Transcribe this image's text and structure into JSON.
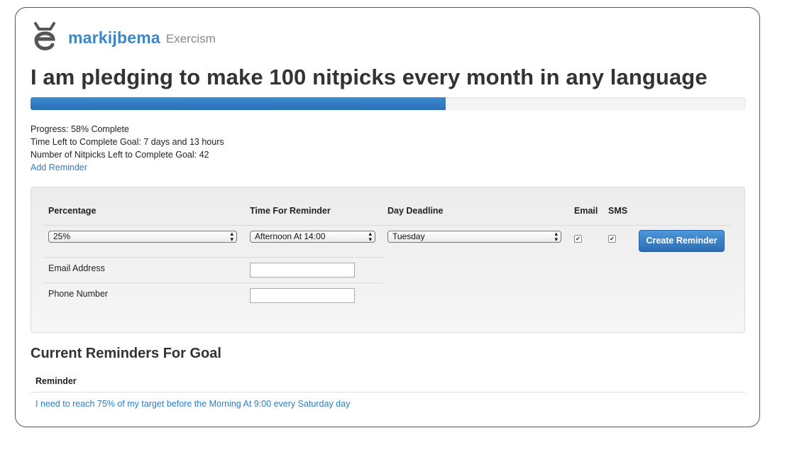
{
  "header": {
    "username": "markijbema",
    "app_name": "Exercism",
    "logo_icon": "exercism-logo-icon"
  },
  "goal": {
    "pledge_text": "I am pledging to make 100 nitpicks every month in any language",
    "progress_fraction": 0.58,
    "progress_text": "Progress: 58% Complete",
    "time_left_text": "Time Left to Complete Goal: 7 days and 13 hours",
    "nitpicks_left_text": "Number of Nitpicks Left to Complete Goal: 42",
    "add_reminder_link": "Add Reminder"
  },
  "form": {
    "headers": {
      "percentage": "Percentage",
      "time": "Time For Reminder",
      "day": "Day Deadline",
      "email": "Email",
      "sms": "SMS"
    },
    "percentage_value": "25%",
    "time_value": "Afternoon At 14:00",
    "day_value": "Tuesday",
    "email_checked": true,
    "sms_checked": true,
    "create_button": "Create Reminder",
    "email_label": "Email Address",
    "email_value": "",
    "phone_label": "Phone Number",
    "phone_value": ""
  },
  "reminders": {
    "title": "Current Reminders For Goal",
    "column_header": "Reminder",
    "rows": [
      "I need to reach 75% of my target before the Morning At 9:00 every Saturday day"
    ]
  },
  "colors": {
    "brand": "#3a87c9",
    "progress_fill": "#2f7dc4",
    "button": "#3a80c6",
    "link": "#2f7dc4"
  }
}
